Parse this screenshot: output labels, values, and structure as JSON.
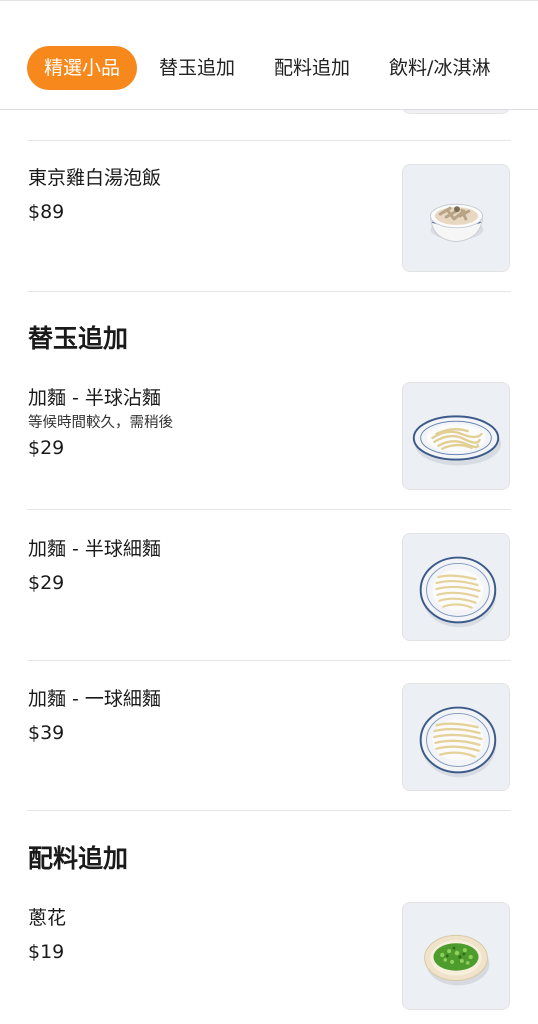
{
  "tabs": [
    {
      "label": "精選小品",
      "active": true
    },
    {
      "label": "替玉追加",
      "active": false
    },
    {
      "label": "配料追加",
      "active": false
    },
    {
      "label": "飲料/冰淇淋",
      "active": false
    }
  ],
  "colors": {
    "accent": "#f7891c"
  },
  "featured_item": {
    "name": "東京雞白湯泡飯",
    "price": "$89",
    "image": "chicken-rice-bowl"
  },
  "sections": [
    {
      "title": "替玉追加",
      "items": [
        {
          "name": "加麵 - 半球沾麵",
          "note": "等候時間較久，需稍後",
          "price": "$29",
          "image": "dipping-noodles-plate"
        },
        {
          "name": "加麵 - 半球細麵",
          "price": "$29",
          "image": "thin-noodles-bowl"
        },
        {
          "name": "加麵 - 一球細麵",
          "price": "$39",
          "image": "thin-noodles-bowl"
        }
      ]
    },
    {
      "title": "配料追加",
      "items": [
        {
          "name": "蔥花",
          "price": "$19",
          "image": "chopped-scallion-dish"
        }
      ]
    }
  ]
}
